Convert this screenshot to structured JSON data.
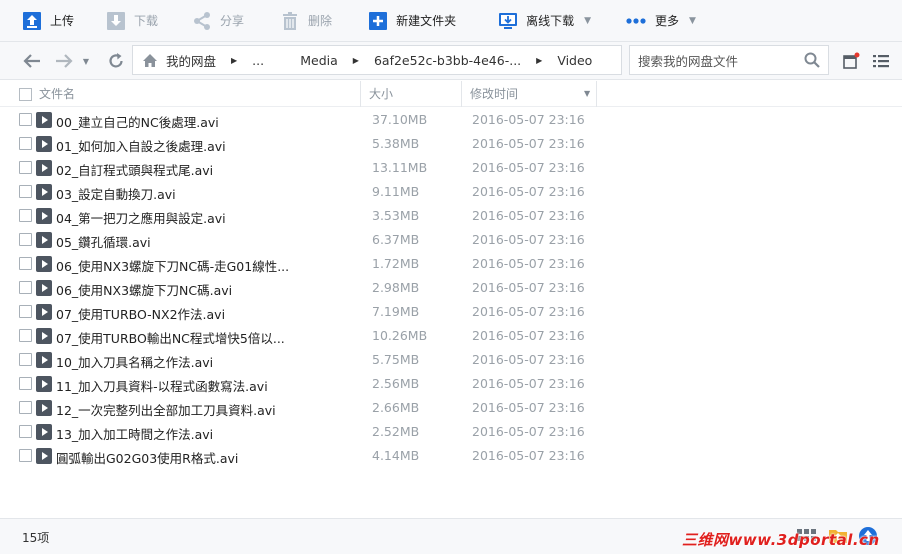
{
  "toolbar": {
    "upload": "上传",
    "download": "下载",
    "share": "分享",
    "delete": "删除",
    "new_folder": "新建文件夹",
    "offline_download": "离线下载",
    "more": "更多"
  },
  "breadcrumb": {
    "items": [
      "我的网盘",
      "...",
      "Media",
      "6af2e52c-b3bb-4e46-...",
      "Video"
    ]
  },
  "search": {
    "placeholder": "搜索我的网盘文件"
  },
  "columns": {
    "name": "文件名",
    "size": "大小",
    "modified": "修改时间"
  },
  "files": [
    {
      "name": "00_建立自己的NC後處理.avi",
      "size": "37.10MB",
      "date": "2016-05-07 23:16"
    },
    {
      "name": "01_如何加入自設之後處理.avi",
      "size": "5.38MB",
      "date": "2016-05-07 23:16"
    },
    {
      "name": "02_自訂程式頭與程式尾.avi",
      "size": "13.11MB",
      "date": "2016-05-07 23:16"
    },
    {
      "name": "03_設定自動換刀.avi",
      "size": "9.11MB",
      "date": "2016-05-07 23:16"
    },
    {
      "name": "04_第一把刀之應用與設定.avi",
      "size": "3.53MB",
      "date": "2016-05-07 23:16"
    },
    {
      "name": "05_鑽孔循環.avi",
      "size": "6.37MB",
      "date": "2016-05-07 23:16"
    },
    {
      "name": "06_使用NX3螺旋下刀NC碼-走G01線性...",
      "size": "1.72MB",
      "date": "2016-05-07 23:16"
    },
    {
      "name": "06_使用NX3螺旋下刀NC碼.avi",
      "size": "2.98MB",
      "date": "2016-05-07 23:16"
    },
    {
      "name": "07_使用TURBO-NX2作法.avi",
      "size": "7.19MB",
      "date": "2016-05-07 23:16"
    },
    {
      "name": "07_使用TURBO輸出NC程式增快5倍以...",
      "size": "10.26MB",
      "date": "2016-05-07 23:16"
    },
    {
      "name": "10_加入刀具名稱之作法.avi",
      "size": "5.75MB",
      "date": "2016-05-07 23:16"
    },
    {
      "name": "11_加入刀具資料-以程式函數寫法.avi",
      "size": "2.56MB",
      "date": "2016-05-07 23:16"
    },
    {
      "name": "12_一次完整列出全部加工刀具資料.avi",
      "size": "2.66MB",
      "date": "2016-05-07 23:16"
    },
    {
      "name": "13_加入加工時間之作法.avi",
      "size": "2.52MB",
      "date": "2016-05-07 23:16"
    },
    {
      "name": "圓弧輸出G02G03使用R格式.avi",
      "size": "4.14MB",
      "date": "2016-05-07 23:16"
    }
  ],
  "status": {
    "count": "15项"
  },
  "watermark": "三维网www.3dportal.cn",
  "colors": {
    "accent": "#1e6fd9",
    "disabled": "#9aa3ad",
    "watermark": "#e0201e"
  }
}
